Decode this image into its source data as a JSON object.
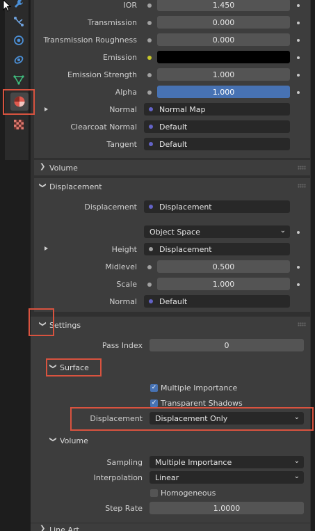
{
  "sidebar_tabs": [
    "wrench-icon",
    "particles-icon",
    "physics-icon",
    "constraints-icon",
    "data-icon",
    "material-icon",
    "texture-icon"
  ],
  "principled": {
    "ior": {
      "label": "IOR",
      "value": "1.450"
    },
    "transmission": {
      "label": "Transmission",
      "value": "0.000"
    },
    "transmission_roughness": {
      "label": "Transmission Roughness",
      "value": "0.000"
    },
    "emission": {
      "label": "Emission"
    },
    "emission_strength": {
      "label": "Emission Strength",
      "value": "1.000"
    },
    "alpha": {
      "label": "Alpha",
      "value": "1.000"
    },
    "normal": {
      "label": "Normal",
      "value": "Normal Map"
    },
    "clearcoat_normal": {
      "label": "Clearcoat Normal",
      "value": "Default"
    },
    "tangent": {
      "label": "Tangent",
      "value": "Default"
    }
  },
  "volume_panel": {
    "title": "Volume"
  },
  "displacement_panel": {
    "title": "Displacement",
    "displacement": {
      "label": "Displacement",
      "value": "Displacement"
    },
    "space": {
      "value": "Object Space"
    },
    "height": {
      "label": "Height",
      "value": "Displacement"
    },
    "midlevel": {
      "label": "Midlevel",
      "value": "0.500"
    },
    "scale": {
      "label": "Scale",
      "value": "1.000"
    },
    "normal": {
      "label": "Normal",
      "value": "Default"
    }
  },
  "settings_panel": {
    "title": "Settings",
    "pass_index": {
      "label": "Pass Index",
      "value": "0"
    },
    "surface": {
      "title": "Surface",
      "multiple_importance": "Multiple Importance",
      "transparent_shadows": "Transparent Shadows",
      "displacement": {
        "label": "Displacement",
        "value": "Displacement Only"
      }
    },
    "volume": {
      "title": "Volume",
      "sampling": {
        "label": "Sampling",
        "value": "Multiple Importance"
      },
      "interpolation": {
        "label": "Interpolation",
        "value": "Linear"
      },
      "homogeneous": "Homogeneous",
      "step_rate": {
        "label": "Step Rate",
        "value": "1.0000"
      }
    }
  },
  "line_art_panel": {
    "title": "Line Art"
  },
  "colors": {
    "accent": "#4772b3",
    "highlight_box": "#d9533f",
    "shader_socket": "#6363c7",
    "color_socket": "#c7c729"
  }
}
